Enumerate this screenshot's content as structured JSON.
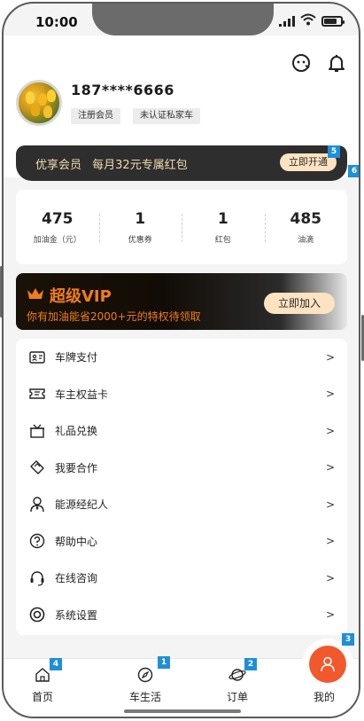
{
  "status_bar": {
    "time": "10:00"
  },
  "user": {
    "phone": "187****6666",
    "tags": [
      "注册会员",
      "未认证私家车"
    ]
  },
  "promo": {
    "title": "优享会员",
    "subtitle": "每月32元专属红包",
    "button": "立即开通"
  },
  "stats": [
    {
      "value": "475",
      "label": "加油金（元）"
    },
    {
      "value": "1",
      "label": "优惠券"
    },
    {
      "value": "1",
      "label": "红包"
    },
    {
      "value": "485",
      "label": "油滴"
    }
  ],
  "vip": {
    "title": "超级VIP",
    "subtitle": "你有加油能省2000+元的特权待领取",
    "button": "立即加入"
  },
  "menu": [
    {
      "label": "车牌支付",
      "icon": "license-plate-icon"
    },
    {
      "label": "车主权益卡",
      "icon": "ticket-icon"
    },
    {
      "label": "礼品兑换",
      "icon": "gift-box-icon"
    },
    {
      "label": "我要合作",
      "icon": "handshake-icon"
    },
    {
      "label": "能源经纪人",
      "icon": "agent-person-icon"
    },
    {
      "label": "帮助中心",
      "icon": "question-circle-icon"
    },
    {
      "label": "在线咨询",
      "icon": "headset-icon"
    },
    {
      "label": "系统设置",
      "icon": "settings-icon"
    }
  ],
  "menu_chevron": ">",
  "tabs": [
    {
      "label": "首页",
      "icon": "home-icon"
    },
    {
      "label": "车生活",
      "icon": "compass-icon"
    },
    {
      "label": "订单",
      "icon": "planet-icon"
    },
    {
      "label": "我的",
      "icon": "user-icon"
    }
  ],
  "badges": [
    "1",
    "2",
    "3",
    "4",
    "5",
    "6"
  ],
  "colors": {
    "accent_orange": "#f07d1b",
    "fab_orange": "#f2582d",
    "cream_button": "#fde3c0",
    "badge_blue": "#1e8fd8",
    "dark_banner": "#2e2e2e"
  }
}
